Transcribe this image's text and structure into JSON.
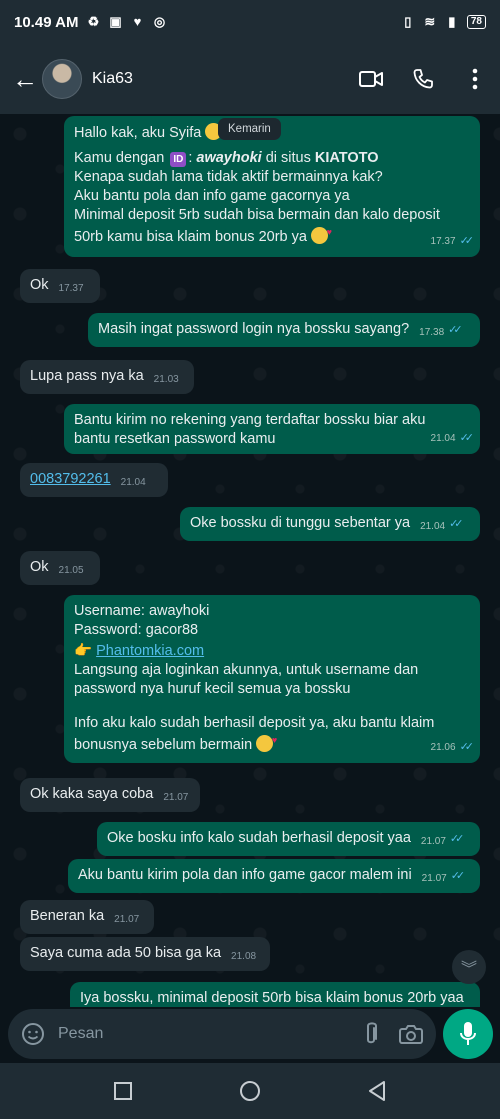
{
  "status_bar": {
    "time": "10.49 AM",
    "battery": "78",
    "icons": [
      "sync-icon",
      "sim-icon",
      "heart-app-icon",
      "game-icon",
      "vibrate-icon",
      "wifi-icon",
      "signal-icon"
    ]
  },
  "header": {
    "contact_name": "Kia63",
    "icons": [
      "back-arrow-icon",
      "video-call-icon",
      "voice-call-icon",
      "more-vert-icon"
    ]
  },
  "chat": {
    "date_chip": "Kemarin",
    "messages": [
      {
        "direction": "out",
        "intro": "Hallo kak, aku Syifa",
        "line2_pre": "Kamu dengan",
        "line2_id": "ID",
        "line2_user": "awayhoki",
        "line2_mid": "di situs",
        "line2_site": "KIATOTO",
        "line3": "Kenapa sudah lama tidak aktif bermainnya kak?",
        "line4": "Aku bantu pola dan info game gacornya ya",
        "line5": "Minimal deposit 5rb sudah bisa bermain dan kalo deposit",
        "line6": "50rb kamu bisa klaim bonus 20rb ya",
        "time": "17.37",
        "ticks": "✓✓"
      },
      {
        "direction": "in",
        "text": "Ok",
        "time": "17.37"
      },
      {
        "direction": "out",
        "text": "Masih ingat password login nya bossku sayang?",
        "time": "17.38",
        "ticks": "✓✓"
      },
      {
        "direction": "in",
        "text": "Lupa pass nya ka",
        "time": "21.03"
      },
      {
        "direction": "out",
        "line1": "Bantu kirim no rekening yang terdaftar bossku biar aku",
        "line2": "bantu resetkan password kamu",
        "time": "21.04",
        "ticks": "✓✓"
      },
      {
        "direction": "in",
        "text": "0083792261",
        "time": "21.04"
      },
      {
        "direction": "out",
        "text": "Oke bossku di tunggu sebentar ya",
        "time": "21.04",
        "ticks": "✓✓"
      },
      {
        "direction": "in",
        "text": "Ok",
        "time": "21.05"
      },
      {
        "direction": "out",
        "line1": "Username: awayhoki",
        "line2": "Password: gacor88",
        "link": "Phantomkia.com",
        "line4": "Langsung aja loginkan akunnya, untuk username dan",
        "line5": "password nya huruf kecil semua ya bossku",
        "line6": "Info aku kalo sudah berhasil deposit ya, aku bantu klaim",
        "line7": "bonusnya sebelum bermain",
        "time": "21.06",
        "ticks": "✓✓"
      },
      {
        "direction": "in",
        "text": "Ok kaka saya coba",
        "time": "21.07"
      },
      {
        "direction": "out",
        "text": "Oke bosku info kalo sudah berhasil deposit yaa",
        "time": "21.07",
        "ticks": "✓✓"
      },
      {
        "direction": "out",
        "text": "Aku bantu kirim pola dan info game gacor malem ini",
        "time": "21.07",
        "ticks": "✓✓"
      },
      {
        "direction": "in",
        "text": "Beneran ka",
        "time": "21.07"
      },
      {
        "direction": "in",
        "text": "Saya cuma ada 50 bisa ga ka",
        "time": "21.08"
      },
      {
        "direction": "out",
        "text": "Iya bossku, minimal deposit 50rb bisa klaim bonus 20rb yaa"
      }
    ]
  },
  "input": {
    "placeholder": "Pesan",
    "icons": [
      "sticker-icon",
      "attach-icon",
      "camera-icon",
      "mic-icon"
    ]
  },
  "nav": {
    "icons": [
      "recents-square-icon",
      "home-circle-icon",
      "back-triangle-icon"
    ]
  },
  "colors": {
    "background": "#0b141a",
    "header": "#1f2c34",
    "outgoing_bubble": "#005c4b",
    "incoming_bubble": "#202c33",
    "accent": "#00a884",
    "ticks": "#53bdeb"
  }
}
